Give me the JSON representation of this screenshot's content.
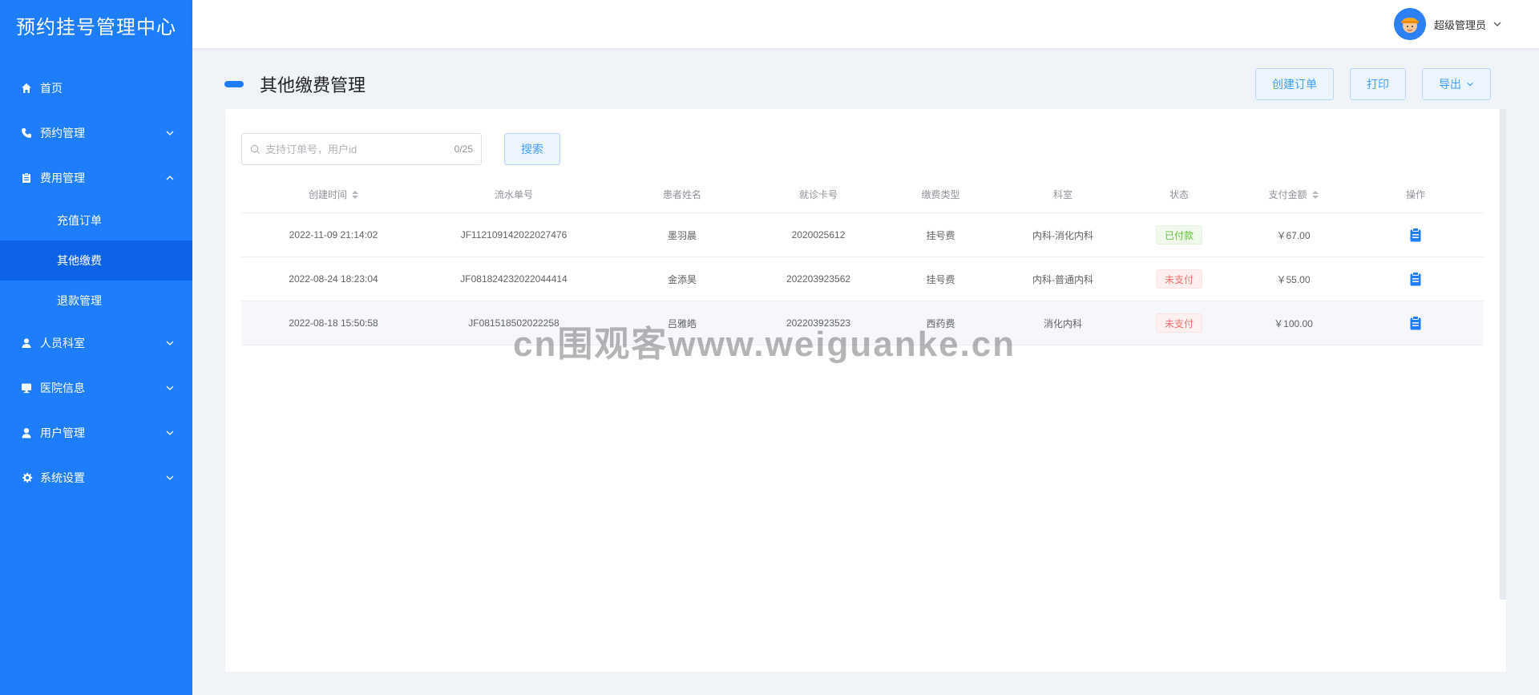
{
  "sidebar": {
    "brand": "预约挂号管理中心",
    "items": [
      {
        "label": "首页"
      },
      {
        "label": "预约管理"
      },
      {
        "label": "费用管理"
      },
      {
        "label": "人员科室"
      },
      {
        "label": "医院信息"
      },
      {
        "label": "用户管理"
      },
      {
        "label": "系统设置"
      }
    ],
    "sub_items": [
      {
        "label": "充值订单"
      },
      {
        "label": "其他缴费"
      },
      {
        "label": "退款管理"
      }
    ]
  },
  "header": {
    "user_name": "超级管理员"
  },
  "page": {
    "title": "其他缴费管理",
    "actions": {
      "create": "创建订单",
      "print": "打印",
      "export": "导出"
    }
  },
  "search": {
    "placeholder": "支持订单号，用户id",
    "counter": "0/25",
    "button": "搜索"
  },
  "table": {
    "columns": [
      "创建时间",
      "流水单号",
      "患者姓名",
      "就诊卡号",
      "缴费类型",
      "科室",
      "状态",
      "支付金额",
      "操作"
    ],
    "rows": [
      {
        "time": "2022-11-09 21:14:02",
        "serial": "JF112109142022027476",
        "name": "墨羽晨",
        "card": "2020025612",
        "type": "挂号费",
        "dept": "内科-消化内科",
        "status": "已付款",
        "amount": "￥67.00"
      },
      {
        "time": "2022-08-24 18:23:04",
        "serial": "JF081824232022044414",
        "name": "金添昊",
        "card": "202203923562",
        "type": "挂号费",
        "dept": "内科-普通内科",
        "status": "未支付",
        "amount": "￥55.00"
      },
      {
        "time": "2022-08-18 15:50:58",
        "serial": "JF081518502022258",
        "name": "吕雅皓",
        "card": "202203923523",
        "type": "西药费",
        "dept": "消化内科",
        "status": "未支付",
        "amount": "￥100.00"
      }
    ]
  },
  "watermark": "cn围观客www.weiguanke.cn",
  "colors": {
    "primary": "#1d7dfa",
    "sidebar_active": "#0d63e8",
    "paid": "#67c23a",
    "unpaid": "#f56c6c"
  }
}
